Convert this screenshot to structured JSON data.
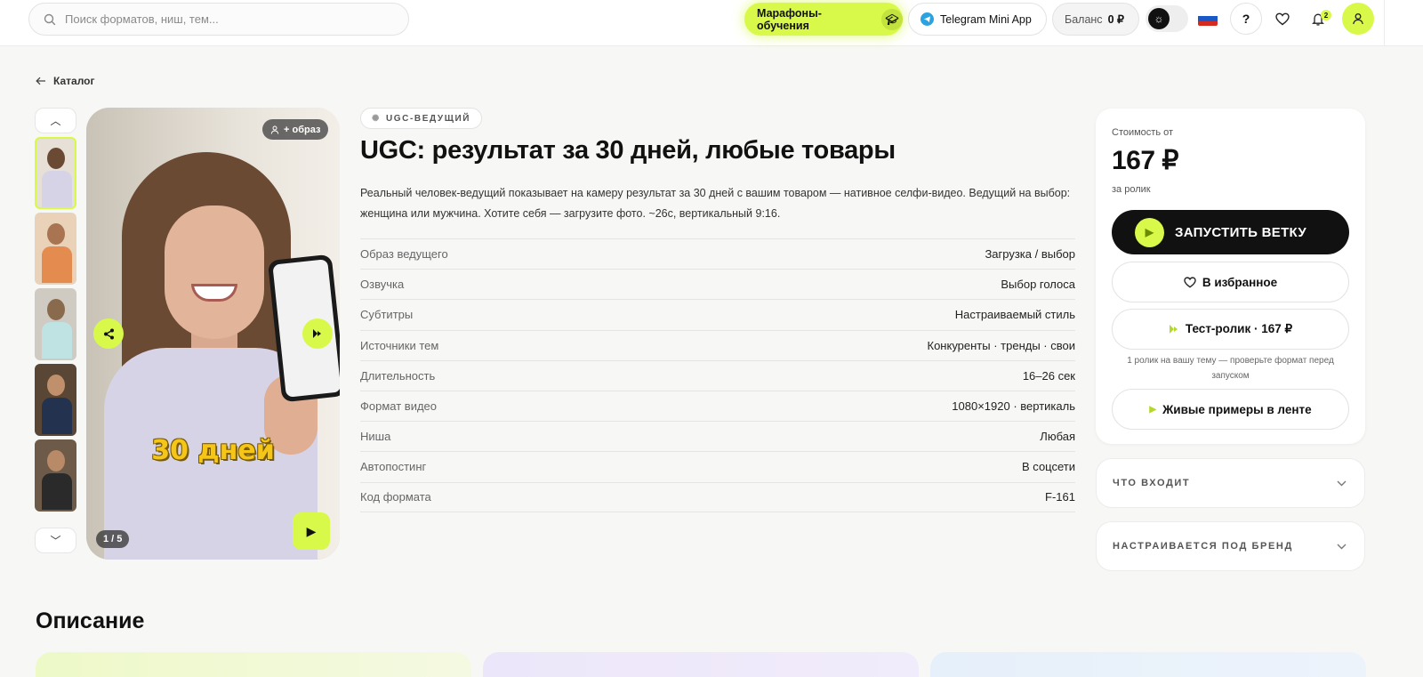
{
  "header": {
    "search_placeholder": "Поиск форматов, ниш, тем...",
    "marathon_label": "Марафоны-обучения",
    "telegram_label": "Telegram Mini App",
    "balance_label": "Баланс",
    "balance_value": "0 ₽",
    "help_label": "?",
    "notifications_count": "2"
  },
  "breadcrumb": {
    "label": "Каталог"
  },
  "gallery": {
    "badge_label": "+ образ",
    "caption": "30 дней",
    "counter": "1 / 5"
  },
  "product": {
    "tag": "UGC-ВЕДУЩИЙ",
    "title": "UGC: результат за 30 дней, любые товары",
    "description": "Реальный человек-ведущий показывает на камеру результат за 30 дней с вашим товаром — нативное селфи-видео. Ведущий на выбор: женщина или мужчина. Хотите себя — загрузите фото. ~26с, вертикальный 9:16.",
    "specs": [
      {
        "label": "Образ ведущего",
        "value": "Загрузка / выбор"
      },
      {
        "label": "Озвучка",
        "value": "Выбор голоса"
      },
      {
        "label": "Субтитры",
        "value": "Настраиваемый стиль"
      },
      {
        "label": "Источники тем",
        "value": "Конкуренты · тренды · свои"
      },
      {
        "label": "Длительность",
        "value": "16–26 сек"
      },
      {
        "label": "Формат видео",
        "value": "1080×1920 · вертикаль"
      },
      {
        "label": "Ниша",
        "value": "Любая"
      },
      {
        "label": "Автопостинг",
        "value": "В соцсети"
      },
      {
        "label": "Код формата",
        "value": "F-161"
      }
    ]
  },
  "pricing": {
    "from_label": "Стоимость от",
    "price": "167 ₽",
    "per_label": "за ролик",
    "launch_label": "ЗАПУСТИТЬ ВЕТКУ",
    "favorite_label": "В избранное",
    "test_label": "Тест-ролик · 167 ₽",
    "test_note": "1 ролик на вашу тему — проверьте формат перед запуском",
    "live_label": "Живые примеры в ленте"
  },
  "accordions": {
    "included": "ЧТО ВХОДИТ",
    "brand": "НАСТРАИВАЕТСЯ ПОД БРЕНД"
  },
  "description_section": {
    "title": "Описание"
  },
  "colors": {
    "accent": "#d8f94a",
    "dark": "#111111"
  }
}
